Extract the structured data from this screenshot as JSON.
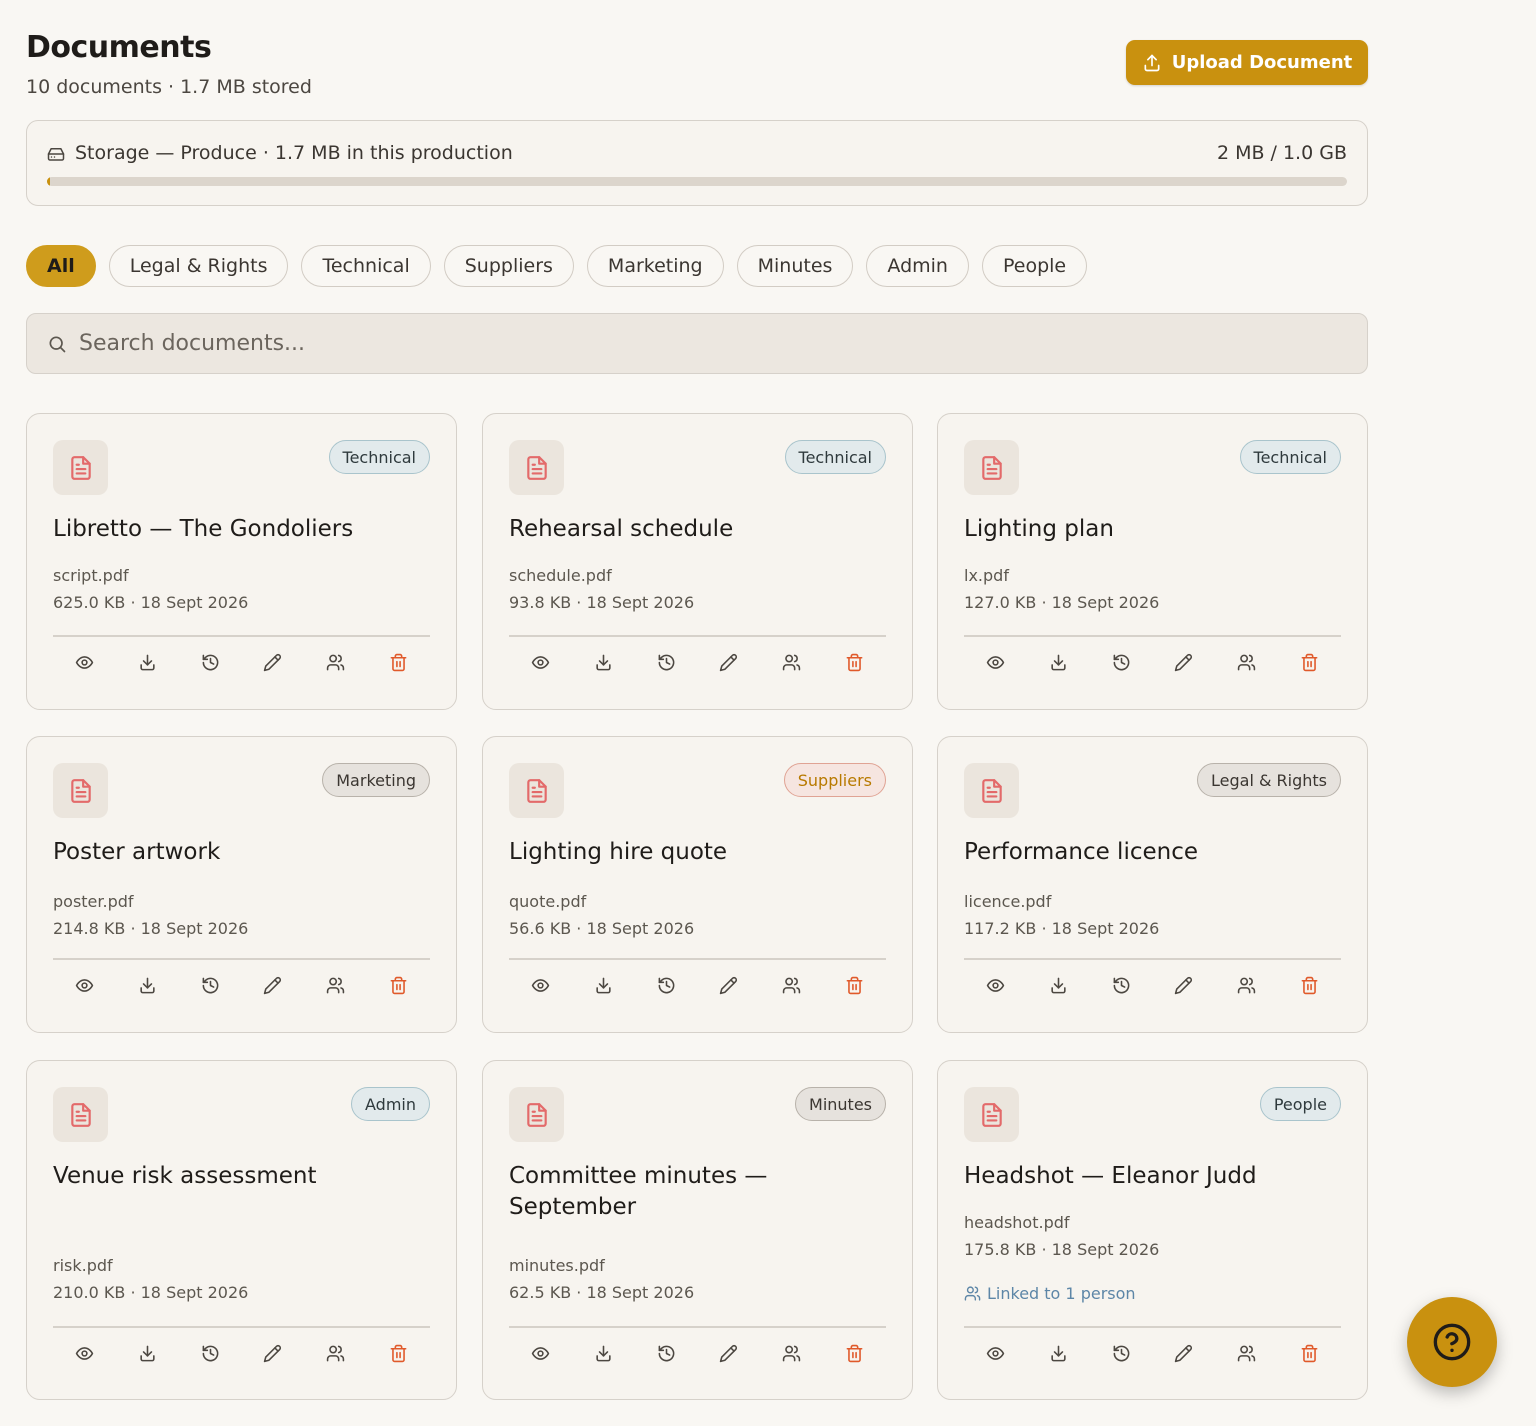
{
  "header": {
    "title": "Documents",
    "subtitle": "10 documents · 1.7 MB stored",
    "upload_label": "Upload Document"
  },
  "storage": {
    "label": "Storage — Produce · 1.7 MB in this production",
    "amount": "2 MB / 1.0 GB",
    "used_fraction": 0.002
  },
  "filters": [
    "All",
    "Legal & Rights",
    "Technical",
    "Suppliers",
    "Marketing",
    "Minutes",
    "Admin",
    "People"
  ],
  "active_filter": "All",
  "search": {
    "placeholder": "Search documents..."
  },
  "documents": [
    {
      "title": "Libretto — The Gondoliers",
      "file": "script.pdf",
      "meta": "625.0 KB · 18 Sept 2026",
      "tag": "Technical",
      "tag_style": "blue",
      "linked": ""
    },
    {
      "title": "Rehearsal schedule",
      "file": "schedule.pdf",
      "meta": "93.8 KB · 18 Sept 2026",
      "tag": "Technical",
      "tag_style": "blue",
      "linked": ""
    },
    {
      "title": "Lighting plan",
      "file": "lx.pdf",
      "meta": "127.0 KB · 18 Sept 2026",
      "tag": "Technical",
      "tag_style": "blue",
      "linked": ""
    },
    {
      "title": "Poster artwork",
      "file": "poster.pdf",
      "meta": "214.8 KB · 18 Sept 2026",
      "tag": "Marketing",
      "tag_style": "gray",
      "linked": ""
    },
    {
      "title": "Lighting hire quote",
      "file": "quote.pdf",
      "meta": "56.6 KB · 18 Sept 2026",
      "tag": "Suppliers",
      "tag_style": "amber",
      "linked": ""
    },
    {
      "title": "Performance licence",
      "file": "licence.pdf",
      "meta": "117.2 KB · 18 Sept 2026",
      "tag": "Legal & Rights",
      "tag_style": "gray",
      "linked": ""
    },
    {
      "title": "Venue risk assessment",
      "file": "risk.pdf",
      "meta": "210.0 KB · 18 Sept 2026",
      "tag": "Admin",
      "tag_style": "blue",
      "linked": ""
    },
    {
      "title": "Committee minutes — September",
      "file": "minutes.pdf",
      "meta": "62.5 KB · 18 Sept 2026",
      "tag": "Minutes",
      "tag_style": "gray",
      "linked": ""
    },
    {
      "title": "Headshot — Eleanor Judd",
      "file": "headshot.pdf",
      "meta": "175.8 KB · 18 Sept 2026",
      "tag": "People",
      "tag_style": "blue",
      "linked": "Linked to 1 person"
    }
  ],
  "card_actions": [
    "eye-icon",
    "download-icon",
    "history-icon",
    "pencil-icon",
    "people-icon",
    "trash-icon"
  ],
  "colors": {
    "accent": "#c9910f",
    "danger": "#e0592a",
    "file_icon": "#e36a6a",
    "link": "#5d86a7"
  }
}
